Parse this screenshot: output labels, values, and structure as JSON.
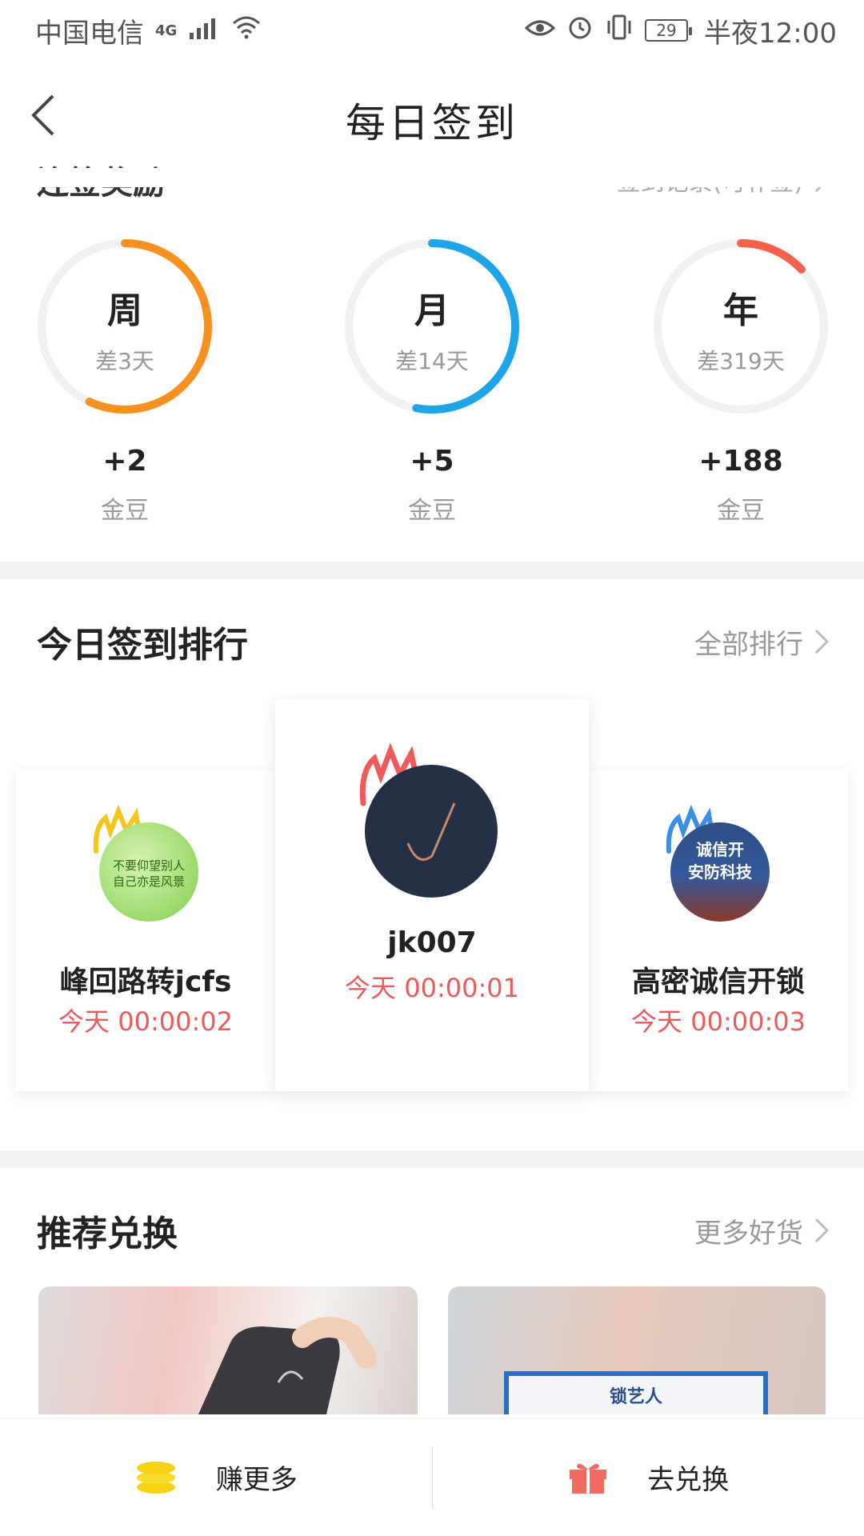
{
  "status_bar": {
    "carrier": "中国电信",
    "network": "4G",
    "battery": "29",
    "time": "半夜12:00"
  },
  "nav": {
    "title": "每日签到",
    "back_icon": "chevron-left-icon"
  },
  "streak": {
    "title": "连签奖励",
    "link": "签到记录(可补签)",
    "items": [
      {
        "label": "周",
        "remaining": "差3天",
        "reward": "+2",
        "unit": "金豆",
        "color": "#f7901e",
        "progress": 0.57
      },
      {
        "label": "月",
        "remaining": "差14天",
        "reward": "+5",
        "unit": "金豆",
        "color": "#1ea5e9",
        "progress": 0.53
      },
      {
        "label": "年",
        "remaining": "差319天",
        "reward": "+188",
        "unit": "金豆",
        "color": "#f5614a",
        "progress": 0.13
      }
    ]
  },
  "ranking": {
    "title": "今日签到排行",
    "link": "全部排行",
    "entries": [
      {
        "rank": 2,
        "name": "峰回路转jcfs",
        "time": "今天 00:00:02",
        "crown_color": "#f5c518",
        "avatar_text_1": "不要仰望别人",
        "avatar_text_2": "自己亦是风景"
      },
      {
        "rank": 1,
        "name": "jk007",
        "time": "今天 00:00:01",
        "crown_color": "#f05a5a"
      },
      {
        "rank": 3,
        "name": "高密诚信开锁",
        "time": "今天 00:00:03",
        "crown_color": "#3a8ee6",
        "avatar_text_1": "诚信开",
        "avatar_text_2": "安防科技"
      }
    ]
  },
  "recommend": {
    "title": "推荐兑换",
    "link": "更多好货",
    "product_2_brand": "锁艺人"
  },
  "bottom": {
    "earn_label": "赚更多",
    "exchange_label": "去兑换"
  }
}
